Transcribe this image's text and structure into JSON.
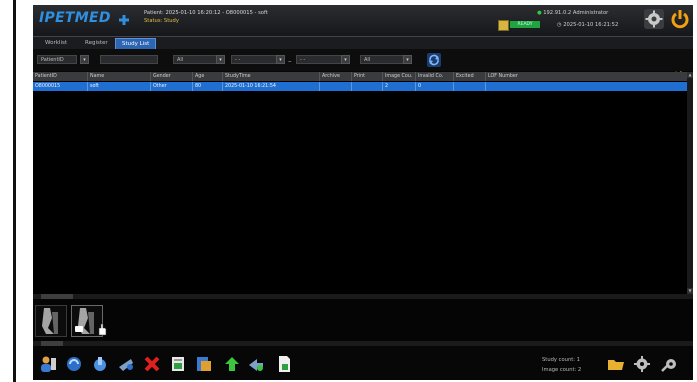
{
  "app": {
    "logo_text": "IPETMED",
    "patient_line": "Patient: 2025-01-10 16:20:12 - O8000015 - soft",
    "status_line": "Status: Study",
    "ready_label": "READY",
    "user_line": "192.91.0.2 Administrator",
    "datetime": "2025-01-10 16:21:52"
  },
  "tabs": [
    {
      "label": "Worklist",
      "active": false
    },
    {
      "label": "Register",
      "active": false
    },
    {
      "label": "Study List",
      "active": true
    }
  ],
  "plus_minus": "+/-",
  "filter": {
    "field_select": "PatientID",
    "search_value": "",
    "modality_select": "All",
    "date_from": "- -",
    "date_to": "- -",
    "status_select": "All"
  },
  "table": {
    "columns": [
      "PatientID",
      "Name",
      "Gender",
      "Age",
      "StudyTime",
      "Archive",
      "Print",
      "Image Cou.",
      "Invalid Co.",
      "Excited",
      "LOF Number"
    ],
    "rows": [
      [
        "O8000015",
        "soft",
        "Other",
        "80",
        "2025-01-10 16:21:54",
        "",
        "",
        "2",
        "0",
        "",
        ""
      ]
    ]
  },
  "footer": {
    "study_count": "Study count: 1",
    "image_count": "Image count: 2"
  },
  "colors": {
    "accent": "#2d65b3",
    "selected_row": "#1f6fd2",
    "ready": "#1ea540",
    "logo": "#2f8fe0"
  },
  "icons": {
    "toolbar": [
      "new-patient-icon",
      "query-icon",
      "edit-icon",
      "send-icon",
      "delete-icon",
      "export-icon",
      "report-icon",
      "upload-icon",
      "forward-icon",
      "document-icon"
    ],
    "right": [
      "folder-icon",
      "settings-icon",
      "tools-icon"
    ]
  }
}
